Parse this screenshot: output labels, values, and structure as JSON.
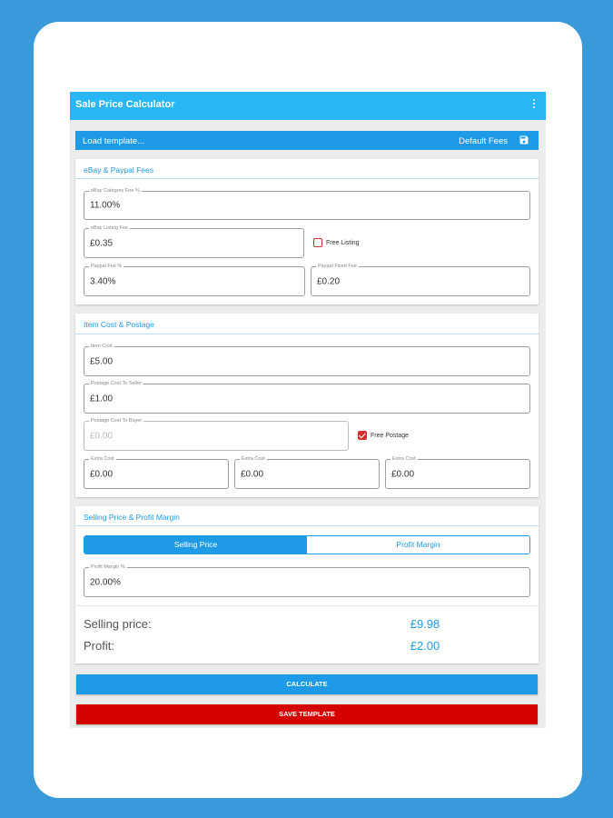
{
  "app": {
    "title": "Sale Price Calculator"
  },
  "template_bar": {
    "load_label": "Load template...",
    "default_label": "Default Fees"
  },
  "fees": {
    "title": "eBay & Paypal Fees",
    "category_fee": {
      "label": "eBay Category Fee %",
      "value": "11.00%"
    },
    "listing_fee": {
      "label": "eBay Listing Fee",
      "value": "£0.35"
    },
    "free_listing": {
      "label": "Free Listing",
      "checked": false
    },
    "paypal_fee": {
      "label": "Paypal Fee %",
      "value": "3.40%"
    },
    "paypal_fixed": {
      "label": "Paypal Fixed Fee",
      "value": "£0.20"
    }
  },
  "costs": {
    "title": "Item Cost & Postage",
    "item_cost": {
      "label": "Item Cost",
      "value": "£5.00"
    },
    "postage_seller": {
      "label": "Postage Cost To Seller",
      "value": "£1.00"
    },
    "postage_buyer": {
      "label": "Postage Cost To Buyer",
      "value": "£0.00"
    },
    "free_postage": {
      "label": "Free Postage",
      "checked": true
    },
    "extra": [
      {
        "label": "Extra Cost",
        "value": "£0.00"
      },
      {
        "label": "Extra Cost",
        "value": "£0.00"
      },
      {
        "label": "Extra Cost",
        "value": "£0.00"
      }
    ]
  },
  "selling": {
    "title": "Selling Price & Profit Margin",
    "tabs": [
      "Selling Price",
      "Profit Margin"
    ],
    "active_tab": "Selling Price",
    "margin": {
      "label": "Profit Margin %",
      "value": "20.00%"
    },
    "selling_label": "Selling price:",
    "selling_value": "£9.98",
    "profit_label": "Profit:",
    "profit_value": "£2.00"
  },
  "buttons": {
    "calculate": "CALCULATE",
    "save_template": "SAVE TEMPLATE"
  },
  "colors": {
    "primary": "#1e9be6",
    "appbar": "#29b6f6",
    "accent_red": "#d50000",
    "background": "#3a9ad9"
  },
  "icons": {
    "menu": "more-vert-icon",
    "save": "floppy-disk-icon"
  }
}
